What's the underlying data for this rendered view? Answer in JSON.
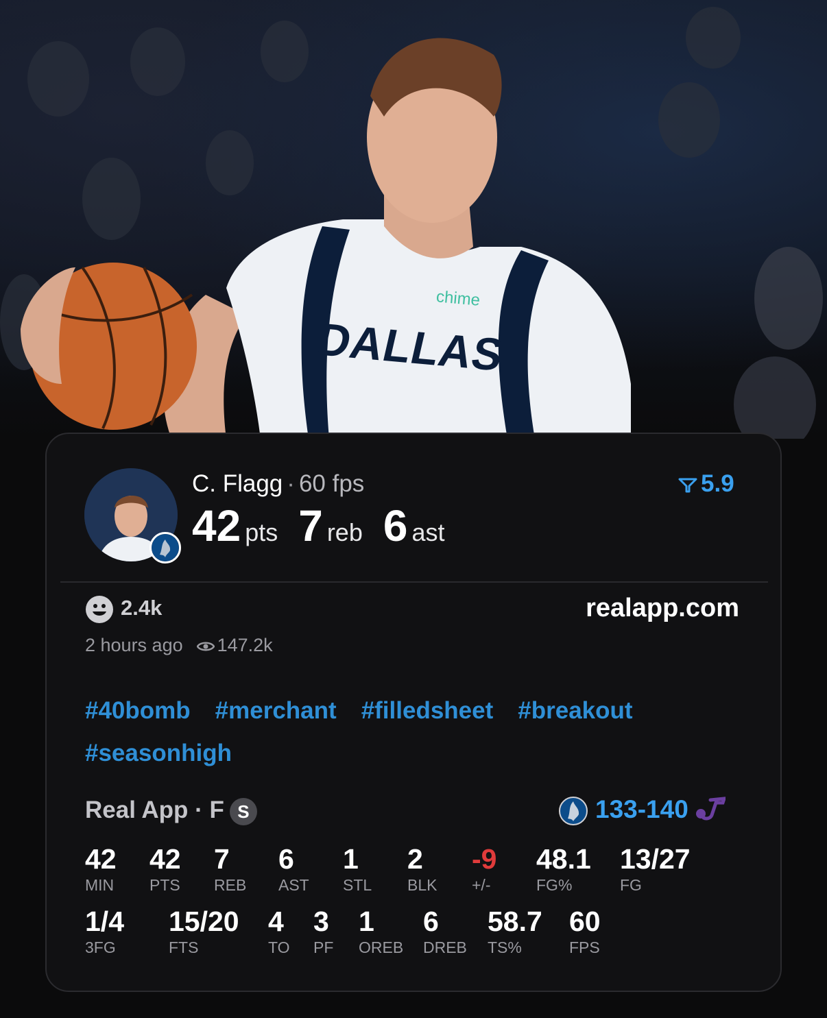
{
  "player": {
    "name": "C. Flagg",
    "fps": "60 fps",
    "pts_value": "42",
    "pts_unit": "pts",
    "reb_value": "7",
    "reb_unit": "reb",
    "ast_value": "6",
    "ast_unit": "ast",
    "rating": "5.9",
    "rating_icon": "filter-funnel-icon",
    "jersey_text": "DALLAS",
    "sponsor": "chime"
  },
  "post": {
    "reactions": "2.4k",
    "reaction_icon": "smiley-icon",
    "site": "realapp.com",
    "time": "2 hours ago",
    "views": "147.2k",
    "views_icon": "eye-icon",
    "tags": [
      "#40bomb",
      "#merchant",
      "#filledsheet",
      "#breakout",
      "#seasonhigh"
    ]
  },
  "game": {
    "source": "Real App",
    "position": "F",
    "badge": "S",
    "score": "133-140",
    "team_color": "#3aa0ef",
    "opponent_color": "#6b3fa0"
  },
  "stats_row1": [
    {
      "value": "42",
      "label": "MIN"
    },
    {
      "value": "42",
      "label": "PTS"
    },
    {
      "value": "7",
      "label": "REB"
    },
    {
      "value": "6",
      "label": "AST"
    },
    {
      "value": "1",
      "label": "STL"
    },
    {
      "value": "2",
      "label": "BLK"
    },
    {
      "value": "-9",
      "label": "+/-"
    },
    {
      "value": "48.1",
      "label": "FG%"
    },
    {
      "value": "13/27",
      "label": "FG"
    }
  ],
  "stats_row2": [
    {
      "value": "1/4",
      "label": "3FG"
    },
    {
      "value": "15/20",
      "label": "FTS"
    },
    {
      "value": "4",
      "label": "TO"
    },
    {
      "value": "3",
      "label": "PF"
    },
    {
      "value": "1",
      "label": "OREB"
    },
    {
      "value": "6",
      "label": "DREB"
    },
    {
      "value": "58.7",
      "label": "TS%"
    },
    {
      "value": "60",
      "label": "FPS"
    }
  ]
}
